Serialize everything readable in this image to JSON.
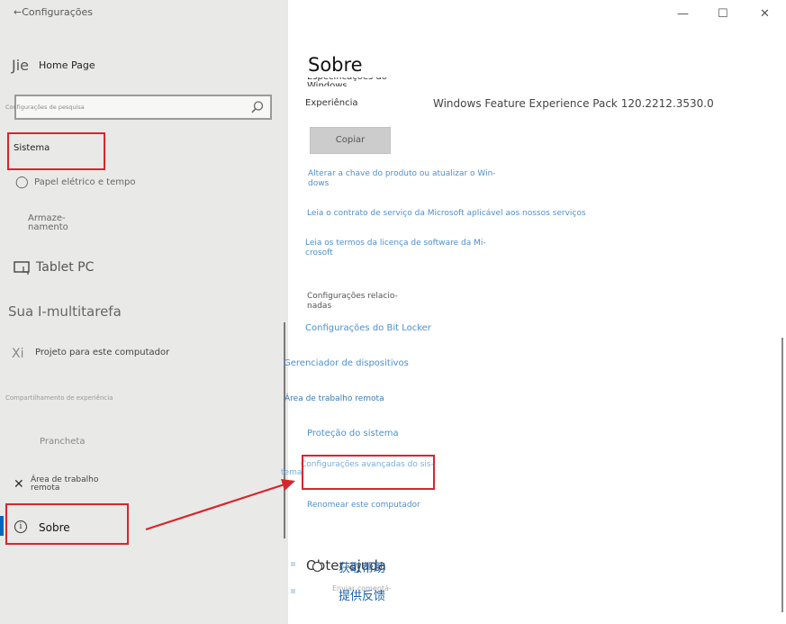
{
  "window": {
    "back_label": "←Configurações",
    "minimize": "—",
    "maximize": "☐",
    "close": "✕"
  },
  "sidebar": {
    "home_glyph": "Jie",
    "home_label": "Home Page",
    "search_placeholder": "Configurações de pesquisa",
    "system_label": "Sistema",
    "items": [
      {
        "icon": "power-icon",
        "glyph": "◯",
        "label": "Papel elétrico e tempo"
      },
      {
        "icon": "storage-icon",
        "glyph": "",
        "label_line1": "Armaze-",
        "label_line2": "namento"
      },
      {
        "icon": "tablet-icon",
        "glyph": "▣",
        "label": "Tablet PC"
      },
      {
        "label": "Sua I-multitarefa"
      },
      {
        "glyph": "Xi",
        "label": "Projeto para este computador"
      },
      {
        "label": "Compartilhamento de experiência"
      },
      {
        "icon": "clipboard-icon",
        "glyph": "",
        "label": "Prancheta"
      },
      {
        "icon": "remote-icon",
        "glyph": "✕",
        "label_line1": "Área de trabalho",
        "label_line2": "remota"
      },
      {
        "icon": "info-icon",
        "glyph": "i",
        "label": "Sobre"
      }
    ]
  },
  "main": {
    "title": "Sobre",
    "ghost_text": "Especificações do Windows",
    "experience_label": "Experiência",
    "experience_value": "Windows Feature Experience Pack 120.2212.3530.0",
    "copy_button": "Copiar",
    "links": [
      {
        "line1": "Alterar a chave do produto ou atualizar o Win-",
        "line2": "dows"
      },
      {
        "line1": "Leia o contrato de serviço da Microsoft aplicável aos nossos serviços"
      },
      {
        "line1": "Leia os termos da licença de software da Mi-",
        "line2": "crosoft"
      }
    ],
    "related_heading_line1": "Configurações relacio-",
    "related_heading_line2": "nadas",
    "related": [
      "Configurações do Bit Locker",
      "Gerenciador de dispositivos",
      "Área de trabalho remota",
      "Proteção do sistema",
      "Configurações avançadas do sis-",
      "tema",
      "Renomear este computador"
    ],
    "help_overlay": "Obter ajuda",
    "help_cn": "获取帮助",
    "feedback_overlay": "Enviar comentá-",
    "feedback_cn": "提供反馈"
  },
  "colors": {
    "annotation_red": "#d6262c",
    "link_blue": "#4e8fcf",
    "accent": "#0067c0"
  }
}
